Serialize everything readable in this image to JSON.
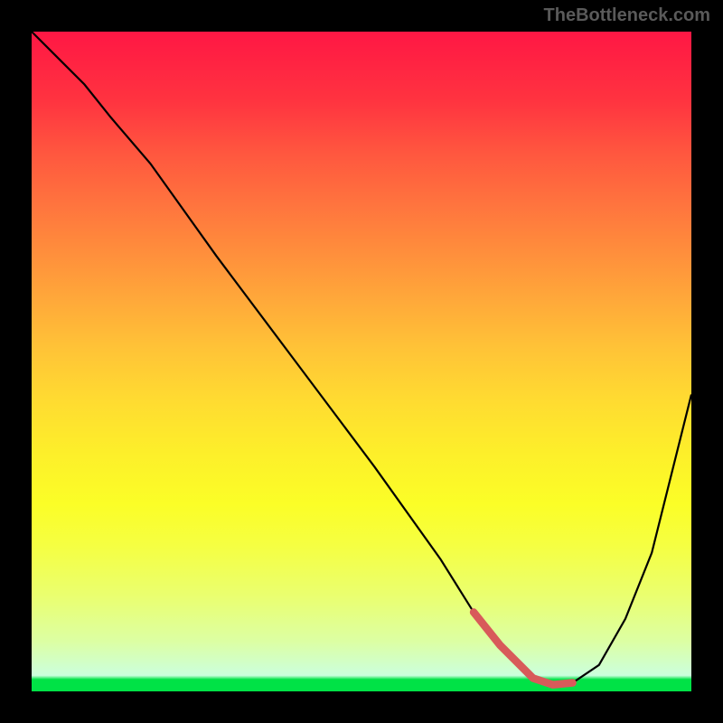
{
  "attribution": "TheBottleneck.com",
  "chart_data": {
    "type": "line",
    "title": "",
    "xlabel": "",
    "ylabel": "",
    "xlim": [
      0,
      100
    ],
    "ylim": [
      0,
      100
    ],
    "series": [
      {
        "name": "curve",
        "x": [
          0,
          4,
          8,
          12,
          18,
          28,
          40,
          52,
          62,
          67,
          71,
          76,
          79,
          82,
          86,
          90,
          94,
          100
        ],
        "y": [
          100,
          96,
          92,
          87,
          80,
          66,
          50,
          34,
          20,
          12,
          7,
          2,
          1,
          1.3,
          4,
          11,
          21,
          45
        ]
      },
      {
        "name": "highlight",
        "x": [
          67,
          71,
          76,
          79,
          82
        ],
        "y": [
          12,
          7,
          2,
          1,
          1.3
        ]
      }
    ],
    "colors": {
      "accent": "#d85a5a",
      "background_top": "#ff1744",
      "background_bottom": "#00e246"
    }
  }
}
